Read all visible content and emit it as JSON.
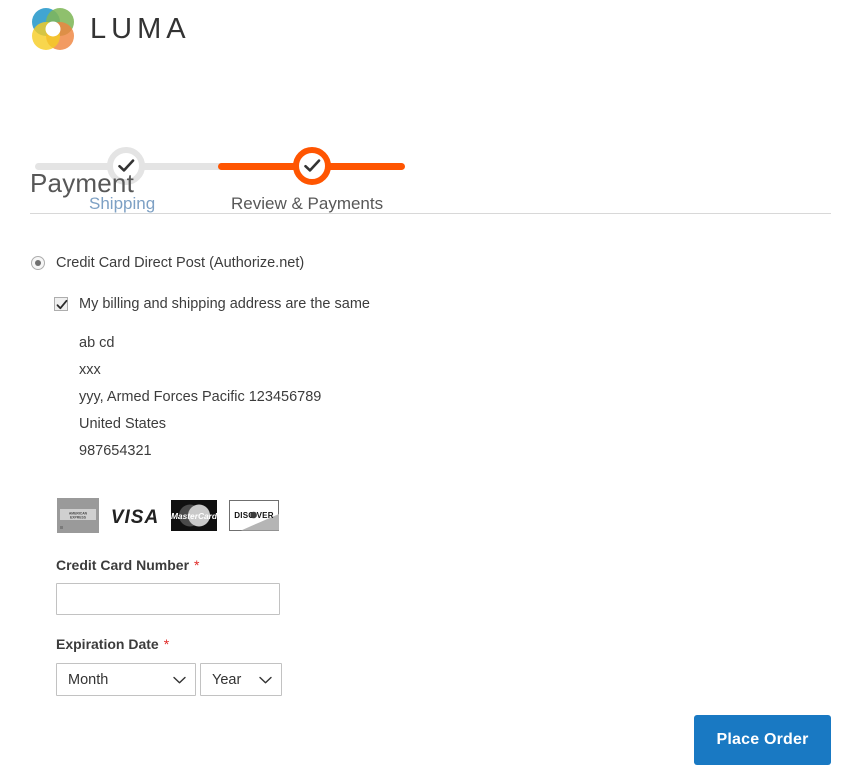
{
  "brand": {
    "name": "LUMA",
    "logo_icon": "luma-rings-logo",
    "colors": {
      "blue": "#2196c9",
      "green": "#6aab3c",
      "orange": "#ec6f1f",
      "yellow": "#f4c500"
    }
  },
  "progress": {
    "steps": [
      {
        "label": "Shipping",
        "state": "complete",
        "icon": "check-icon",
        "color": "#7da0c4"
      },
      {
        "label": "Review & Payments",
        "state": "active",
        "icon": "check-icon",
        "color": "#575757"
      }
    ],
    "bar_inactive_color": "#e4e4e4",
    "bar_active_color": "#ff5501"
  },
  "page": {
    "title": "Payment"
  },
  "payment": {
    "method": {
      "label": "Credit Card Direct Post (Authorize.net)",
      "selected": true
    },
    "billing_same": {
      "label": "My billing and shipping address are the same",
      "checked": true
    },
    "address": [
      "ab cd",
      "xxx",
      "yyy, Armed Forces Pacific 123456789",
      "United States",
      "987654321"
    ],
    "accepted_cards": [
      {
        "name": "American Express",
        "icon": "amex-card-icon"
      },
      {
        "name": "VISA",
        "icon": "visa-card-icon"
      },
      {
        "name": "MasterCard",
        "icon": "mastercard-card-icon"
      },
      {
        "name": "DISCOVER",
        "icon": "discover-card-icon"
      }
    ],
    "fields": {
      "card_number": {
        "label": "Credit Card Number",
        "required_marker": "*",
        "value": "",
        "placeholder": ""
      },
      "expiration": {
        "label": "Expiration Date",
        "required_marker": "*",
        "month": {
          "selected": "Month",
          "icon": "chevron-down-icon"
        },
        "year": {
          "selected": "Year",
          "icon": "chevron-down-icon"
        }
      }
    }
  },
  "actions": {
    "place_order": "Place Order",
    "place_order_color": "#1979c3"
  }
}
